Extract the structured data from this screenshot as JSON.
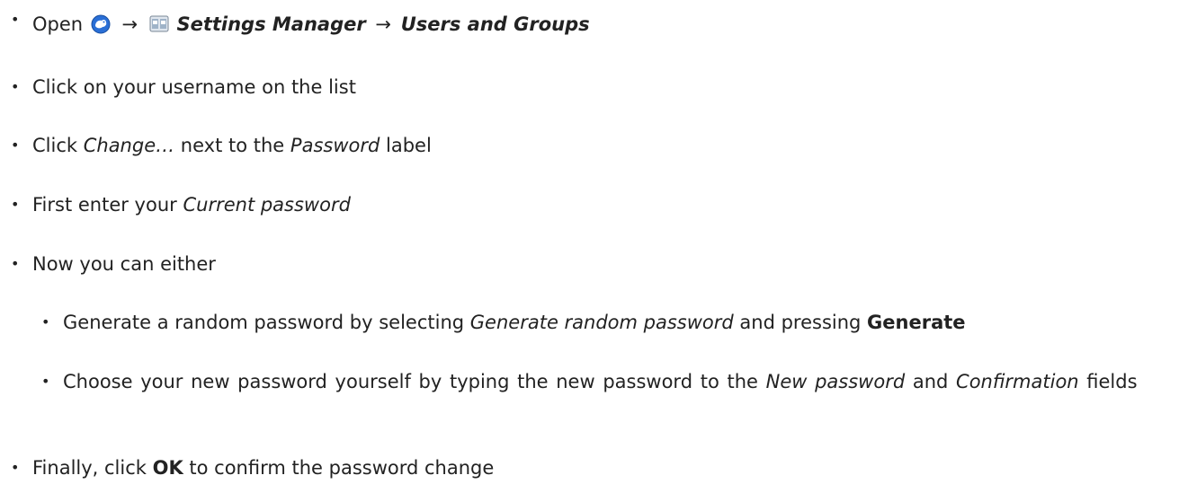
{
  "steps": {
    "step1": {
      "open": "Open",
      "arrow1": "→",
      "settings_manager": "Settings Manager",
      "arrow2": "→",
      "users_and_groups": "Users and Groups"
    },
    "step2": {
      "text": "Click on your username on the list"
    },
    "step3": {
      "pre": "Click ",
      "change": "Change…",
      "mid": " next to the ",
      "password": "Password",
      "post": " label"
    },
    "step4": {
      "pre": "First enter your ",
      "current_password": "Current password"
    },
    "step5": {
      "text": "Now you can either"
    },
    "step5a": {
      "pre": "Generate a random password by selecting ",
      "generate_random": "Generate random password",
      "mid": " and pressing ",
      "generate": "Generate"
    },
    "step5b": {
      "pre": "Choose your new password yourself by typing the new password to the ",
      "new_password": "New password",
      "mid": " and ",
      "confirmation": "Confirmation",
      "post": " fields"
    },
    "step6": {
      "pre": "Finally, click ",
      "ok": "OK",
      "post": " to confirm the password change"
    }
  },
  "icons": {
    "xfce_logo": "xfce-menu-icon",
    "settings": "settings-manager-icon"
  },
  "colors": {
    "text": "#222222",
    "xfce_blue": "#2a6fd6"
  }
}
